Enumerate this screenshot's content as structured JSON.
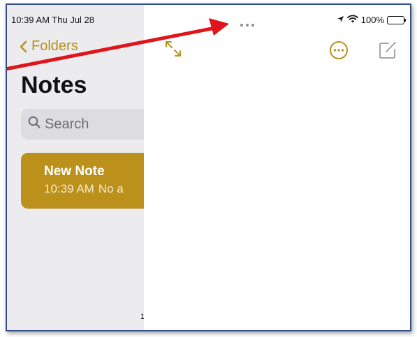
{
  "status_bar": {
    "time_date": "10:39 AM  Thu Jul 28",
    "battery": "100%"
  },
  "sidebar": {
    "back_label": "Folders",
    "title": "Notes",
    "search_placeholder": "Search",
    "notes": [
      {
        "title": "New Note",
        "time": "10:39 AM",
        "preview": "No a"
      }
    ],
    "footer_count": "1"
  },
  "colors": {
    "accent": "#b8921c",
    "note_selected": "#bb911c",
    "sidebar_bg": "#ececef",
    "annotation_arrow": "#e0141b"
  },
  "icons": {
    "back": "chevron-left-icon",
    "search": "magnifier-icon",
    "expand": "expand-diagonal-icon",
    "more": "ellipsis-circle-icon",
    "compose": "compose-icon",
    "multitask": "multitasking-dots-icon",
    "location": "location-arrow-icon",
    "wifi": "wifi-icon",
    "battery": "battery-icon"
  }
}
